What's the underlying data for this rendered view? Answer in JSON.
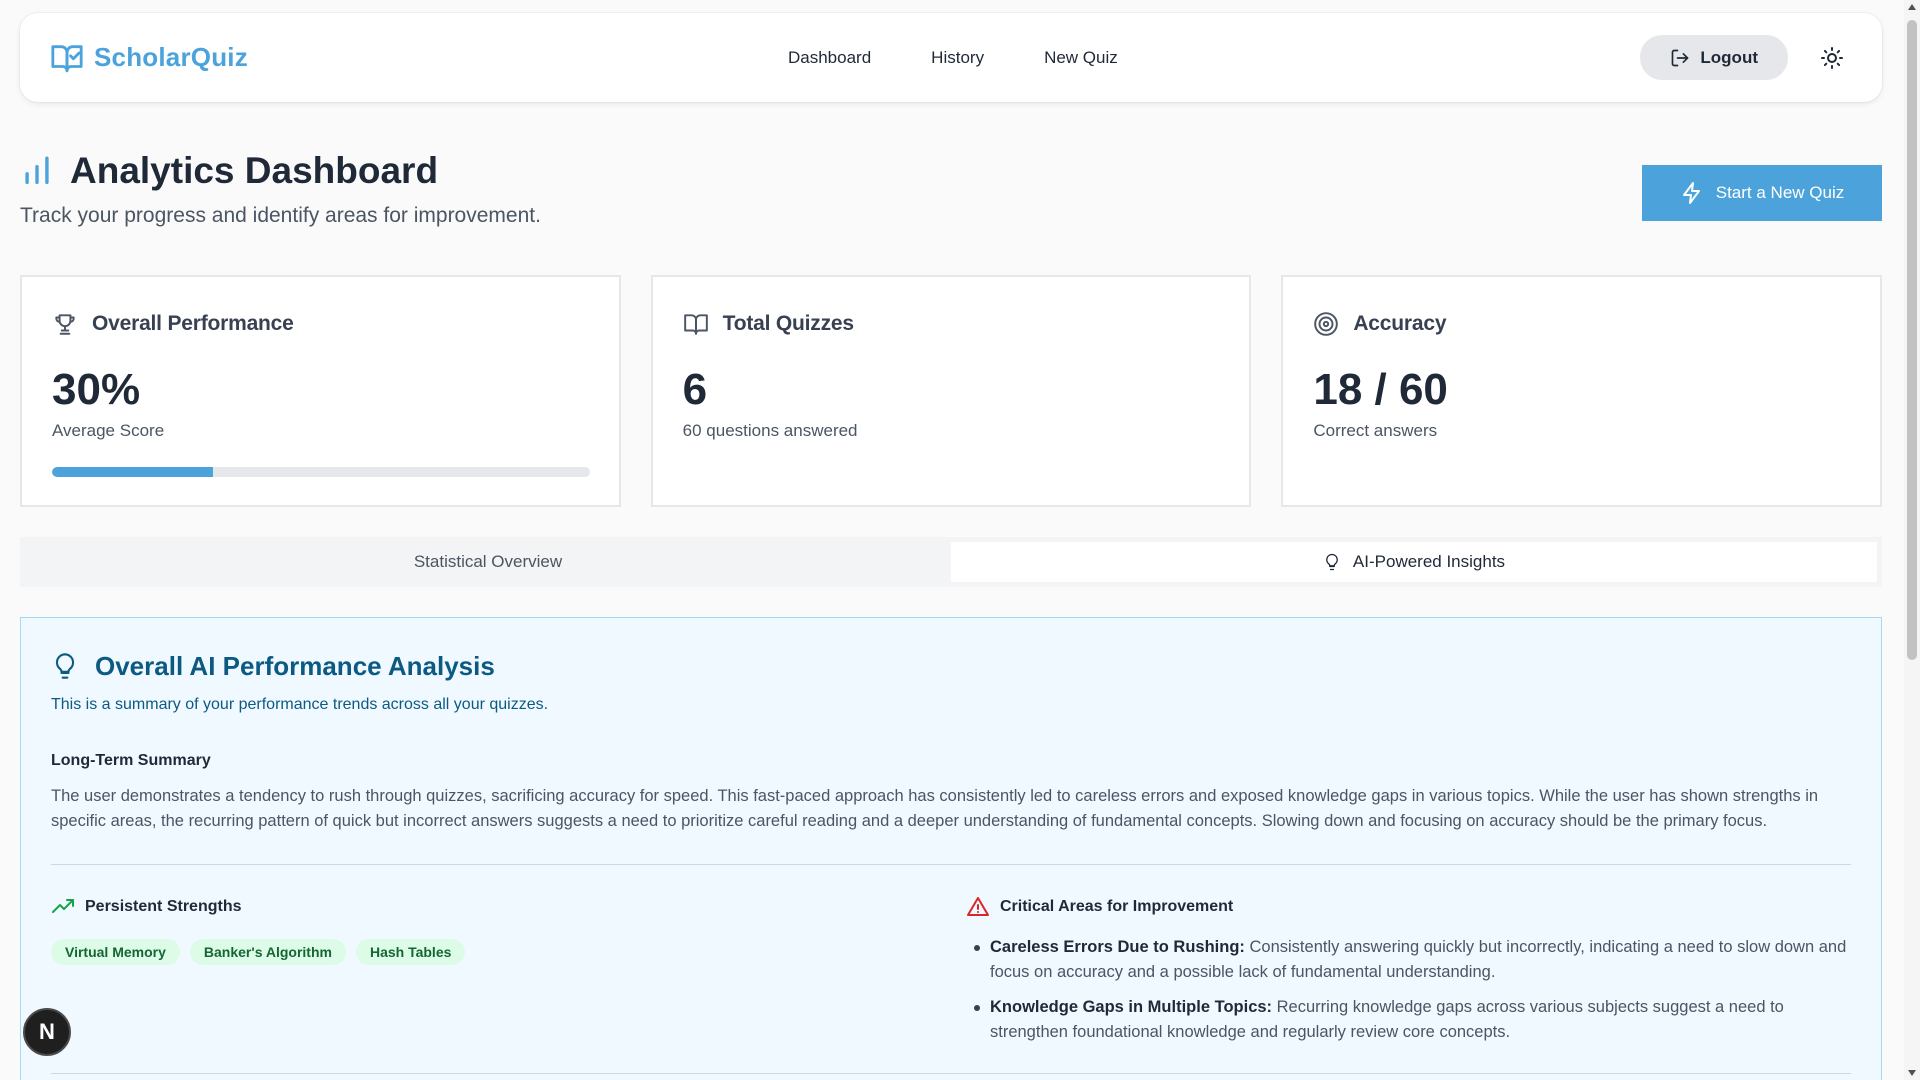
{
  "brand": {
    "name": "ScholarQuiz",
    "color": "#4ca3dc"
  },
  "nav": {
    "links": [
      "Dashboard",
      "History",
      "New Quiz"
    ],
    "logout_label": "Logout",
    "theme_icon": "sun-icon"
  },
  "header": {
    "title": "Analytics Dashboard",
    "subtitle": "Track your progress and identify areas for improvement.",
    "cta_label": "Start a New Quiz",
    "cta_icon": "lightning-icon"
  },
  "cards": [
    {
      "icon": "trophy-icon",
      "title": "Overall Performance",
      "value": "30%",
      "label": "Average Score",
      "progress_percent": 30
    },
    {
      "icon": "book-open-icon",
      "title": "Total Quizzes",
      "value": "6",
      "label": "60 questions answered"
    },
    {
      "icon": "target-icon",
      "title": "Accuracy",
      "value": "18 / 60",
      "label": "Correct answers"
    }
  ],
  "tabs": [
    {
      "label": "Statistical Overview",
      "active": false
    },
    {
      "label": "AI-Powered Insights",
      "active": true,
      "icon": "lightbulb-icon"
    }
  ],
  "insights": {
    "title": "Overall AI Performance Analysis",
    "subtitle": "This is a summary of your performance trends across all your quizzes.",
    "summary_title": "Long-Term Summary",
    "summary_text": "The user demonstrates a tendency to rush through quizzes, sacrificing accuracy for speed. This fast-paced approach has consistently led to careless errors and exposed knowledge gaps in various topics. While the user has shown strengths in specific areas, the recurring pattern of quick but incorrect answers suggests a need to prioritize careful reading and a deeper understanding of fundamental concepts. Slowing down and focusing on accuracy should be the primary focus.",
    "strengths_title": "Persistent Strengths",
    "strengths": [
      "Virtual Memory",
      "Banker's Algorithm",
      "Hash Tables"
    ],
    "improvement_title": "Critical Areas for Improvement",
    "improvements": [
      {
        "label": "Careless Errors Due to Rushing:",
        "text": "Consistently answering quickly but incorrectly, indicating a need to slow down and focus on accuracy and a possible lack of fundamental understanding."
      },
      {
        "label": "Knowledge Gaps in Multiple Topics:",
        "text": "Recurring knowledge gaps across various subjects suggest a need to strengthen foundational knowledge and regularly review core concepts."
      }
    ]
  },
  "fab": {
    "letter": "N"
  },
  "colors": {
    "accent": "#4ca3dc",
    "insight_bg": "#f0f9ff",
    "insight_title": "#0c5a82",
    "chip_bg": "#dcfce7",
    "chip_text": "#166534",
    "warning": "#dc2626",
    "success": "#16a34a"
  }
}
